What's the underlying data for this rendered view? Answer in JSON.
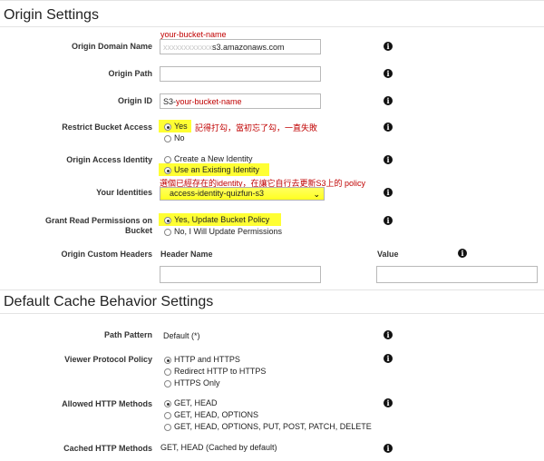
{
  "origin_settings": {
    "title": "Origin Settings",
    "domain": {
      "label": "Origin Domain Name",
      "annotation": "your-bucket-name",
      "value_hidden": "xxxxxxxxxxxx",
      "value_suffix": "s3.amazonaws.com"
    },
    "path": {
      "label": "Origin Path",
      "value": ""
    },
    "origin_id": {
      "label": "Origin ID",
      "value_prefix": "S3-",
      "value_annotation": "your-bucket-name"
    },
    "restrict": {
      "label": "Restrict Bucket Access",
      "yes": "Yes",
      "no": "No",
      "annotation": "記得打勾，當初忘了勾，一直失敗"
    },
    "oai": {
      "label": "Origin Access Identity",
      "create": "Create a New Identity",
      "existing": "Use an Existing Identity",
      "annotation": "選個已經存在的identity，在讓它自行去更新S3上的 policy"
    },
    "identities": {
      "label": "Your Identities",
      "selected": "access-identity-quizfun-s3"
    },
    "grant": {
      "label_line1": "Grant Read Permissions on",
      "label_line2": "Bucket",
      "yes": "Yes, Update Bucket Policy",
      "no": "No, I Will Update Permissions"
    },
    "headers": {
      "label": "Origin Custom Headers",
      "col_name": "Header Name",
      "col_value": "Value"
    }
  },
  "cache_settings": {
    "title": "Default Cache Behavior Settings",
    "path_pattern": {
      "label": "Path Pattern",
      "value": "Default (*)"
    },
    "viewer_protocol": {
      "label": "Viewer Protocol Policy",
      "options": [
        "HTTP and HTTPS",
        "Redirect HTTP to HTTPS",
        "HTTPS Only"
      ]
    },
    "allowed_methods": {
      "label": "Allowed HTTP Methods",
      "options": [
        "GET, HEAD",
        "GET, HEAD, OPTIONS",
        "GET, HEAD, OPTIONS, PUT, POST, PATCH, DELETE"
      ]
    },
    "cached_methods": {
      "label": "Cached HTTP Methods",
      "value": "GET, HEAD (Cached by default)"
    }
  },
  "info_glyph": "i",
  "highlight_color": "#ffff33",
  "annotation_color": "#c00000"
}
